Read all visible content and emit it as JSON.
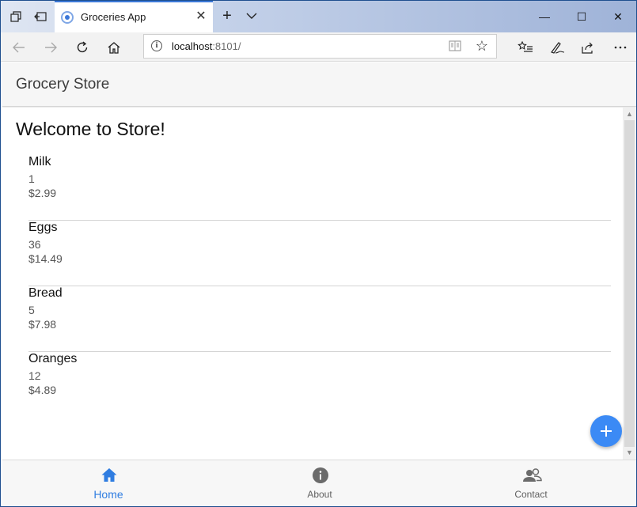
{
  "browser": {
    "tab_title": "Groceries App",
    "tab_close": "✕",
    "new_tab": "+",
    "address": {
      "host": "localhost",
      "port_path": ":8101/"
    },
    "window_controls": {
      "minimize": "—",
      "maximize": "☐",
      "close": "✕"
    }
  },
  "app": {
    "title": "Grocery Store",
    "heading": "Welcome to Store!"
  },
  "items": [
    {
      "name": "Milk",
      "quantity": "1",
      "price": "$2.99"
    },
    {
      "name": "Eggs",
      "quantity": "36",
      "price": "$14.49"
    },
    {
      "name": "Bread",
      "quantity": "5",
      "price": "$7.98"
    },
    {
      "name": "Oranges",
      "quantity": "12",
      "price": "$4.89"
    }
  ],
  "tabs": [
    {
      "label": "Home",
      "icon": "home-icon",
      "active": true
    },
    {
      "label": "About",
      "icon": "info-icon",
      "active": false
    },
    {
      "label": "Contact",
      "icon": "contacts-icon",
      "active": false
    }
  ],
  "colors": {
    "accent": "#3b8af5",
    "active_tab": "#2f7de1",
    "inactive_tab": "#6b6b6b"
  }
}
